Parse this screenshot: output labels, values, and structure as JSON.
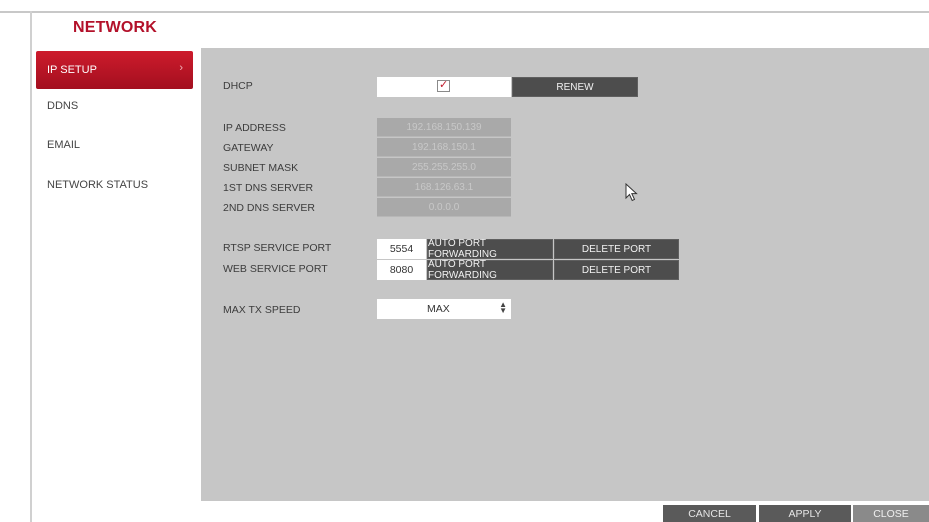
{
  "header": {
    "title": "NETWORK"
  },
  "sidebar": {
    "items": [
      {
        "label": "IP SETUP",
        "active": true
      },
      {
        "label": "DDNS"
      },
      {
        "label": "EMAIL"
      },
      {
        "label": "NETWORK STATUS"
      }
    ],
    "arrow_icon": "chevron-right-icon"
  },
  "dhcp": {
    "label": "DHCP",
    "checked": true,
    "renew_label": "RENEW"
  },
  "ip_fields": [
    {
      "label": "IP ADDRESS",
      "value": "192.168.150.139"
    },
    {
      "label": "GATEWAY",
      "value": "192.168.150.1"
    },
    {
      "label": "SUBNET MASK",
      "value": "255.255.255.0"
    },
    {
      "label": "1ST DNS SERVER",
      "value": "168.126.63.1"
    },
    {
      "label": "2ND DNS SERVER",
      "value": "0.0.0.0"
    }
  ],
  "ports": [
    {
      "label": "RTSP SERVICE PORT",
      "value": "5554",
      "forward_label": "AUTO PORT FORWARDING",
      "delete_label": "DELETE PORT"
    },
    {
      "label": "WEB SERVICE PORT",
      "value": "8080",
      "forward_label": "AUTO PORT FORWARDING",
      "delete_label": "DELETE PORT"
    }
  ],
  "tx_speed": {
    "label": "MAX TX SPEED",
    "value": "MAX"
  },
  "footer": {
    "cancel": "CANCEL",
    "apply": "APPLY",
    "close": "CLOSE"
  },
  "colors": {
    "accent": "#b3112a",
    "content_bg": "#c6c6c6",
    "button_dark": "#4d4d4d"
  }
}
